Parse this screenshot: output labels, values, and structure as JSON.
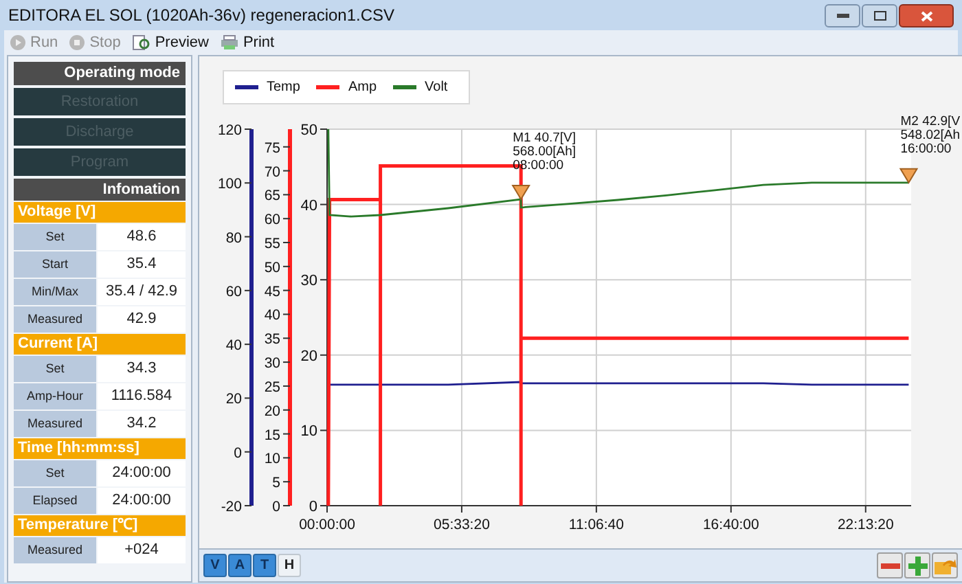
{
  "window": {
    "title": "EDITORA EL SOL (1020Ah-36v) regeneracion1.CSV",
    "controls": [
      {
        "kind": "minimize"
      },
      {
        "kind": "maximize"
      },
      {
        "kind": "close"
      }
    ]
  },
  "toolbar": [
    {
      "label": "Run",
      "kind": "run",
      "disabled": true
    },
    {
      "label": "Stop",
      "kind": "stop",
      "disabled": true
    },
    {
      "label": "Preview",
      "kind": "preview",
      "disabled": false
    },
    {
      "label": "Print",
      "kind": "print",
      "disabled": false
    }
  ],
  "sidebar": {
    "mode_header": "Operating mode",
    "modes": [
      {
        "label": "Restoration",
        "disabled": true
      },
      {
        "label": "Discharge",
        "disabled": true
      },
      {
        "label": "Program",
        "disabled": true
      }
    ],
    "info_header": "Infomation",
    "sections": [
      {
        "title": "Voltage [V]",
        "rows": [
          {
            "label": "Set",
            "value": "48.6"
          },
          {
            "label": "Start",
            "value": "35.4"
          },
          {
            "label": "Min/Max",
            "value": "35.4 / 42.9"
          },
          {
            "label": "Measured",
            "value": "42.9"
          }
        ]
      },
      {
        "title": "Current [A]",
        "rows": [
          {
            "label": "Set",
            "value": "34.3"
          },
          {
            "label": "Amp-Hour",
            "value": "1116.584"
          },
          {
            "label": "Measured",
            "value": "34.2"
          }
        ]
      },
      {
        "title": "Time [hh:mm:ss]",
        "rows": [
          {
            "label": "Set",
            "value": "24:00:00"
          },
          {
            "label": "Elapsed",
            "value": "24:00:00"
          }
        ]
      },
      {
        "title": "Temperature [℃]",
        "rows": [
          {
            "label": "Measured",
            "value": "+024"
          }
        ]
      }
    ]
  },
  "chart": {
    "chart_data": {
      "type": "line",
      "x": [
        0.05,
        0.1,
        1,
        2.2,
        2.2,
        2.2,
        5,
        8,
        8,
        8,
        10,
        12,
        14,
        16,
        18,
        20,
        22,
        24
      ],
      "xlim": [
        0,
        24.1
      ],
      "xticks": [
        {
          "value": 0,
          "label": "00:00:00"
        },
        {
          "value": 5.5556,
          "label": "05:33:20"
        },
        {
          "value": 11.1111,
          "label": "11:06:40"
        },
        {
          "value": 16.6667,
          "label": "16:40:00"
        },
        {
          "value": 22.2222,
          "label": "22:13:20"
        }
      ],
      "grid": true,
      "ylim": [
        0,
        50
      ],
      "yticks": [
        0,
        10,
        20,
        30,
        40,
        50
      ],
      "y2lim": [
        -20,
        120
      ],
      "y2ticks": [
        -20,
        0,
        20,
        40,
        60,
        80,
        100,
        120
      ],
      "y3lim": [
        0,
        78.7
      ],
      "y3ticks": [
        0,
        5,
        10,
        15,
        20,
        25,
        30,
        35,
        40,
        45,
        50,
        55,
        60,
        65,
        70,
        75
      ],
      "series": [
        {
          "name": "Temp",
          "color": "#1f1f8f",
          "axis": "y2",
          "values": [
            null,
            25,
            25,
            25,
            25,
            25,
            25,
            26,
            26,
            25.5,
            25.5,
            25.5,
            25.5,
            25.5,
            25.5,
            25,
            25,
            25
          ]
        },
        {
          "name": "Amp",
          "color": "#ff2020",
          "axis": "y3",
          "values": [
            0,
            64,
            64,
            64,
            0,
            71,
            71,
            71,
            0,
            35,
            35,
            35,
            35,
            35,
            35,
            35,
            35,
            35
          ]
        },
        {
          "name": "Volt",
          "color": "#2a7a2a",
          "values": [
            50,
            38.6,
            38.4,
            38.6,
            38.6,
            38.6,
            39.5,
            40.7,
            40.7,
            39.6,
            40.1,
            40.6,
            41.2,
            41.9,
            42.6,
            42.9,
            42.9,
            42.9
          ]
        }
      ],
      "annotations": [
        {
          "x": 8,
          "y": 40.7,
          "text": "M1 40.7[V]\n568.00[Ah]\n08:00:00"
        },
        {
          "x": 24,
          "y": 42.9,
          "text": "M2 42.9[V\n548.02[Ah\n16:00:00"
        }
      ]
    }
  },
  "bottom_bar": {
    "toggles": [
      {
        "label": "V",
        "selected": true
      },
      {
        "label": "A",
        "selected": true
      },
      {
        "label": "T",
        "selected": true
      },
      {
        "label": "H",
        "selected": false
      }
    ],
    "tools": [
      {
        "kind": "zoom-out"
      },
      {
        "kind": "zoom-in"
      },
      {
        "kind": "reset"
      }
    ]
  }
}
